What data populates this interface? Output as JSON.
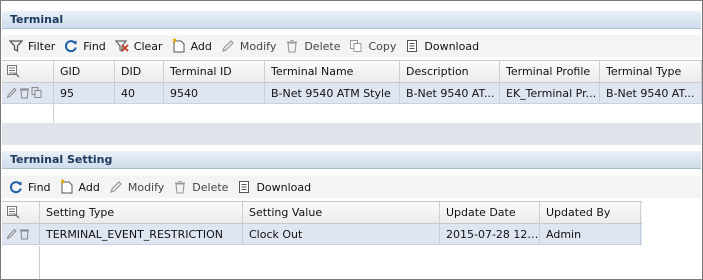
{
  "terminal_panel": {
    "title": "Terminal",
    "toolbar": {
      "filter": "Filter",
      "find": "Find",
      "clear": "Clear",
      "add": "Add",
      "modify": "Modify",
      "delete": "Delete",
      "copy": "Copy",
      "download": "Download"
    },
    "columns": [
      "GID",
      "DID",
      "Terminal ID",
      "Terminal Name",
      "Description",
      "Terminal Profile",
      "Terminal Type"
    ],
    "rows": [
      [
        "95",
        "40",
        "9540",
        "B-Net 9540 ATM Style",
        "B-Net 9540 AT...",
        "EK_Terminal Pr...",
        "B-Net 9540 AT..."
      ]
    ]
  },
  "setting_panel": {
    "title": "Terminal Setting",
    "toolbar": {
      "find": "Find",
      "add": "Add",
      "modify": "Modify",
      "delete": "Delete",
      "download": "Download"
    },
    "columns": [
      "Setting Type",
      "Setting Value",
      "Update Date",
      "Updated By"
    ],
    "rows": [
      [
        "TERMINAL_EVENT_RESTRICTION",
        "Clock Out",
        "2015-07-28 12:...",
        "Admin"
      ]
    ]
  },
  "colors": {
    "header_text": "#1c3a5e",
    "row_selected": "#dfe6f2",
    "icon_blue": "#1d5fa8",
    "icon_red": "#c0392b"
  }
}
